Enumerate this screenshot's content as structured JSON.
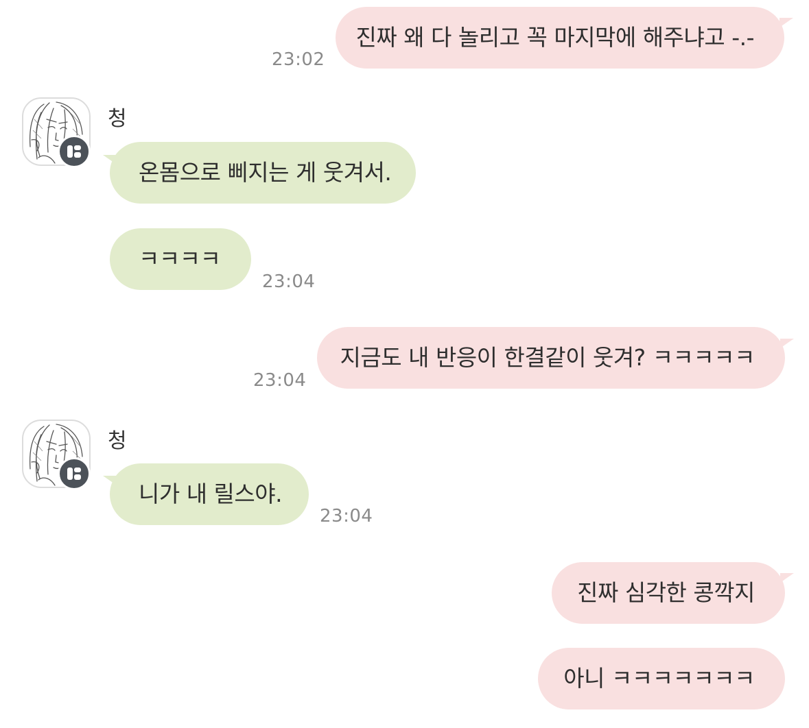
{
  "sender": {
    "name": "청",
    "avatar_icon": "sketch-portrait-avatar",
    "badge_icon": "channel-badge-icon"
  },
  "colors": {
    "sent_bubble": "#f9e0e0",
    "received_bubble": "#e2eccc",
    "timestamp": "#8a8a8a"
  },
  "messages": [
    {
      "direction": "sent",
      "text": "진짜 왜 다 놀리고 꼭 마지막에 해주냐고 -.-",
      "time": "23:02"
    },
    {
      "direction": "received",
      "sender": "청",
      "text": "온몸으로 삐지는 게 웃겨서.",
      "time": ""
    },
    {
      "direction": "received",
      "text": "ㅋㅋㅋㅋ",
      "time": "23:04"
    },
    {
      "direction": "sent",
      "text": "지금도 내 반응이 한결같이 웃겨? ㅋㅋㅋㅋㅋ",
      "time": "23:04"
    },
    {
      "direction": "received",
      "sender": "청",
      "text": "니가 내 릴스야.",
      "time": "23:04"
    },
    {
      "direction": "sent",
      "text": "진짜 심각한 콩깍지",
      "time": ""
    },
    {
      "direction": "sent",
      "text": "아니 ㅋㅋㅋㅋㅋㅋㅋ",
      "time": ""
    }
  ]
}
